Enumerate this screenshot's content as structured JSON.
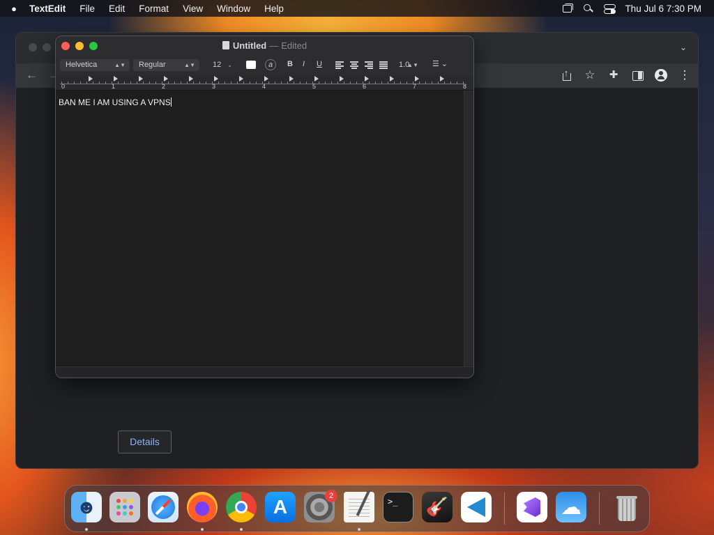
{
  "menubar": {
    "apple_icon": "apple-logo",
    "app_name": "TextEdit",
    "items": [
      "File",
      "Edit",
      "Format",
      "View",
      "Window",
      "Help"
    ],
    "clock": "Thu Jul 6  7:30 PM"
  },
  "browser": {
    "details_label": "Details"
  },
  "textedit": {
    "title": "Untitled",
    "separator": "—",
    "status": "Edited",
    "font_family": "Helvetica",
    "font_style": "Regular",
    "font_size": "12",
    "text_color": "#ffffff",
    "line_spacing": "1.0",
    "bold_label": "B",
    "italic_label": "I",
    "underline_label": "U",
    "highlight_label": "a",
    "ruler_numbers": [
      "0",
      "1",
      "2",
      "3",
      "4",
      "5",
      "6",
      "7",
      "8"
    ],
    "body_text": "BAN ME I AM USING A VPNS"
  },
  "dock": {
    "apps": [
      "Finder",
      "Launchpad",
      "Safari",
      "Firefox",
      "Google Chrome",
      "App Store",
      "System Settings",
      "TextEdit",
      "Terminal",
      "GarageBand",
      "Visual Studio Code",
      "Visual Studio",
      "Weather",
      "Trash"
    ],
    "settings_badge": "2"
  }
}
